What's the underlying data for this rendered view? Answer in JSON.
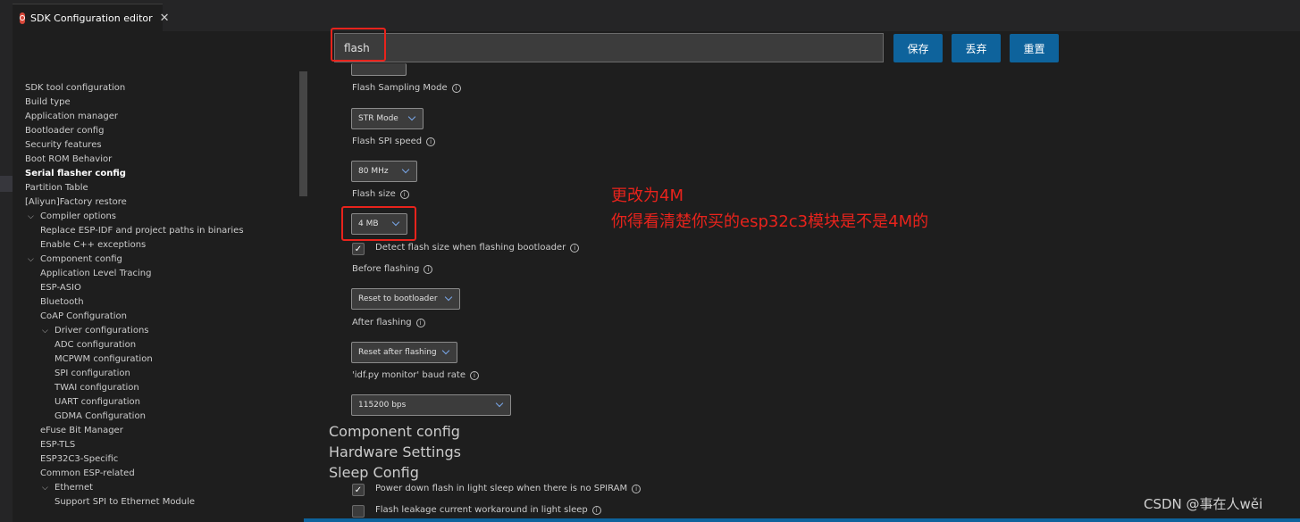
{
  "tab": {
    "title": "SDK Configuration editor",
    "close_glyph": "✕",
    "icon": "espressif-logo-icon"
  },
  "search": {
    "value": "flash"
  },
  "buttons": {
    "save": "保存",
    "discard": "丢弃",
    "reset": "重置"
  },
  "sidebar": [
    {
      "label": "SDK tool configuration",
      "indent": 0
    },
    {
      "label": "Build type",
      "indent": 0
    },
    {
      "label": "Application manager",
      "indent": 0
    },
    {
      "label": "Bootloader config",
      "indent": 0
    },
    {
      "label": "Security features",
      "indent": 0
    },
    {
      "label": "Boot ROM Behavior",
      "indent": 0
    },
    {
      "label": "Serial flasher config",
      "indent": 0,
      "selected": true
    },
    {
      "label": "Partition Table",
      "indent": 0
    },
    {
      "label": "[Aliyun]Factory restore",
      "indent": 0
    },
    {
      "label": "Compiler options",
      "indent": 1,
      "expanded": true
    },
    {
      "label": "Replace ESP-IDF and project paths in binaries",
      "indent": 1
    },
    {
      "label": "Enable C++ exceptions",
      "indent": 1
    },
    {
      "label": "Component config",
      "indent": 1,
      "expanded": true
    },
    {
      "label": "Application Level Tracing",
      "indent": 1
    },
    {
      "label": "ESP-ASIO",
      "indent": 1
    },
    {
      "label": "Bluetooth",
      "indent": 1
    },
    {
      "label": "CoAP Configuration",
      "indent": 1
    },
    {
      "label": "Driver configurations",
      "indent": 2,
      "expanded": true
    },
    {
      "label": "ADC configuration",
      "indent": 2
    },
    {
      "label": "MCPWM configuration",
      "indent": 2
    },
    {
      "label": "SPI configuration",
      "indent": 2
    },
    {
      "label": "TWAI configuration",
      "indent": 2
    },
    {
      "label": "UART configuration",
      "indent": 2
    },
    {
      "label": "GDMA Configuration",
      "indent": 2
    },
    {
      "label": "eFuse Bit Manager",
      "indent": 1
    },
    {
      "label": "ESP-TLS",
      "indent": 1
    },
    {
      "label": "ESP32C3-Specific",
      "indent": 1
    },
    {
      "label": "Common ESP-related",
      "indent": 1
    },
    {
      "label": "Ethernet",
      "indent": 2,
      "expanded": true
    },
    {
      "label": "Support SPI to Ethernet Module",
      "indent": 2
    }
  ],
  "settings": {
    "sampling_mode": {
      "label": "Flash Sampling Mode",
      "value": "STR Mode"
    },
    "spi_speed": {
      "label": "Flash SPI speed",
      "value": "80 MHz"
    },
    "flash_size": {
      "label": "Flash size",
      "value": "4 MB"
    },
    "detect_size": {
      "label": "Detect flash size when flashing bootloader",
      "checked": true
    },
    "before_flashing": {
      "label": "Before flashing",
      "value": "Reset to bootloader"
    },
    "after_flashing": {
      "label": "After flashing",
      "value": "Reset after flashing"
    },
    "monitor_baud": {
      "label": "'idf.py monitor' baud rate",
      "value": "115200 bps"
    }
  },
  "sections": {
    "component_config": "Component config",
    "hardware_settings": "Hardware Settings",
    "sleep_config": "Sleep Config"
  },
  "sleep": {
    "power_down": {
      "label": "Power down flash in light sleep when there is no SPIRAM",
      "checked": true
    },
    "leakage": {
      "label": "Flash leakage current workaround in light sleep",
      "checked": false
    }
  },
  "annotation": {
    "line1": "更改为4M",
    "line2": "你得看清楚你买的esp32c3模块是不是4M的"
  },
  "watermark": "CSDN @事在人wěi",
  "colors": {
    "accent": "#0e639c",
    "highlight": "#e8231c",
    "background": "#1e1e1e"
  }
}
